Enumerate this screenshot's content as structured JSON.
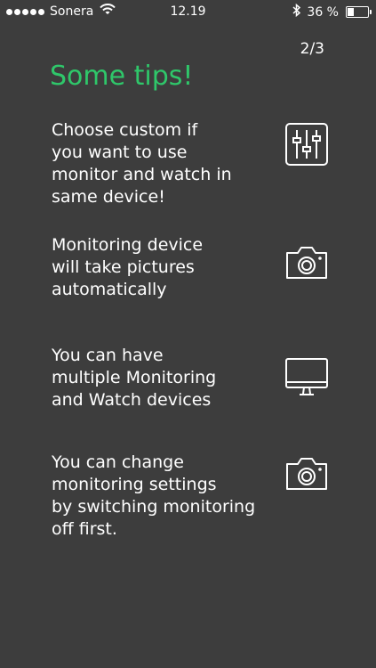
{
  "status_bar": {
    "carrier": "Sonera",
    "time": "12.19",
    "battery_text": "36 %",
    "battery_level": 0.36
  },
  "page": {
    "indicator": "2/3",
    "title": "Some tips!",
    "title_color": "#2fc76a"
  },
  "tips": [
    {
      "text": "Choose custom if\nyou want to use\nmonitor and watch in\nsame device!",
      "icon": "sliders-icon"
    },
    {
      "text": "Monitoring device\nwill take pictures\nautomatically",
      "icon": "camera-icon"
    },
    {
      "text": "You can have\nmultiple Monitoring\nand Watch devices",
      "icon": "monitor-icon"
    },
    {
      "text": "You can change\nmonitoring settings\nby switching monitoring\noff first.",
      "icon": "camera-icon"
    }
  ]
}
